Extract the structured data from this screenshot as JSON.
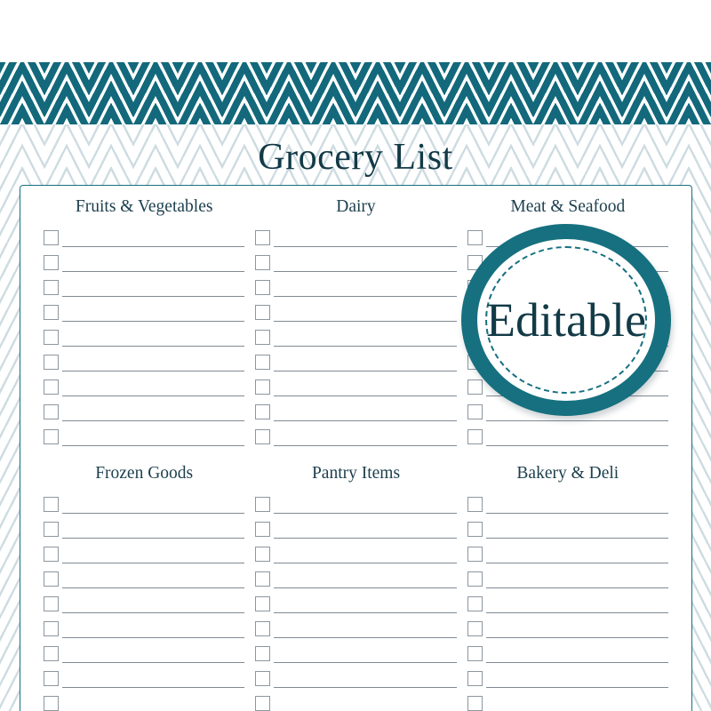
{
  "page": {
    "title": "Grocery List",
    "accent_teal": "#13697b",
    "border_teal": "#17707f",
    "title_color": "#123a47",
    "line_gray": "#808a94",
    "checkbox_gray": "#8d96a0"
  },
  "badge": {
    "label": "Editable",
    "ring_color": "#16707f",
    "text_color": "#123a47"
  },
  "sections": [
    {
      "title": "Fruits & Vegetables",
      "rows": 9
    },
    {
      "title": "Dairy",
      "rows": 9
    },
    {
      "title": "Meat & Seafood",
      "rows": 9
    },
    {
      "title": "Frozen Goods",
      "rows": 9
    },
    {
      "title": "Pantry Items",
      "rows": 9
    },
    {
      "title": "Bakery & Deli",
      "rows": 9
    }
  ]
}
